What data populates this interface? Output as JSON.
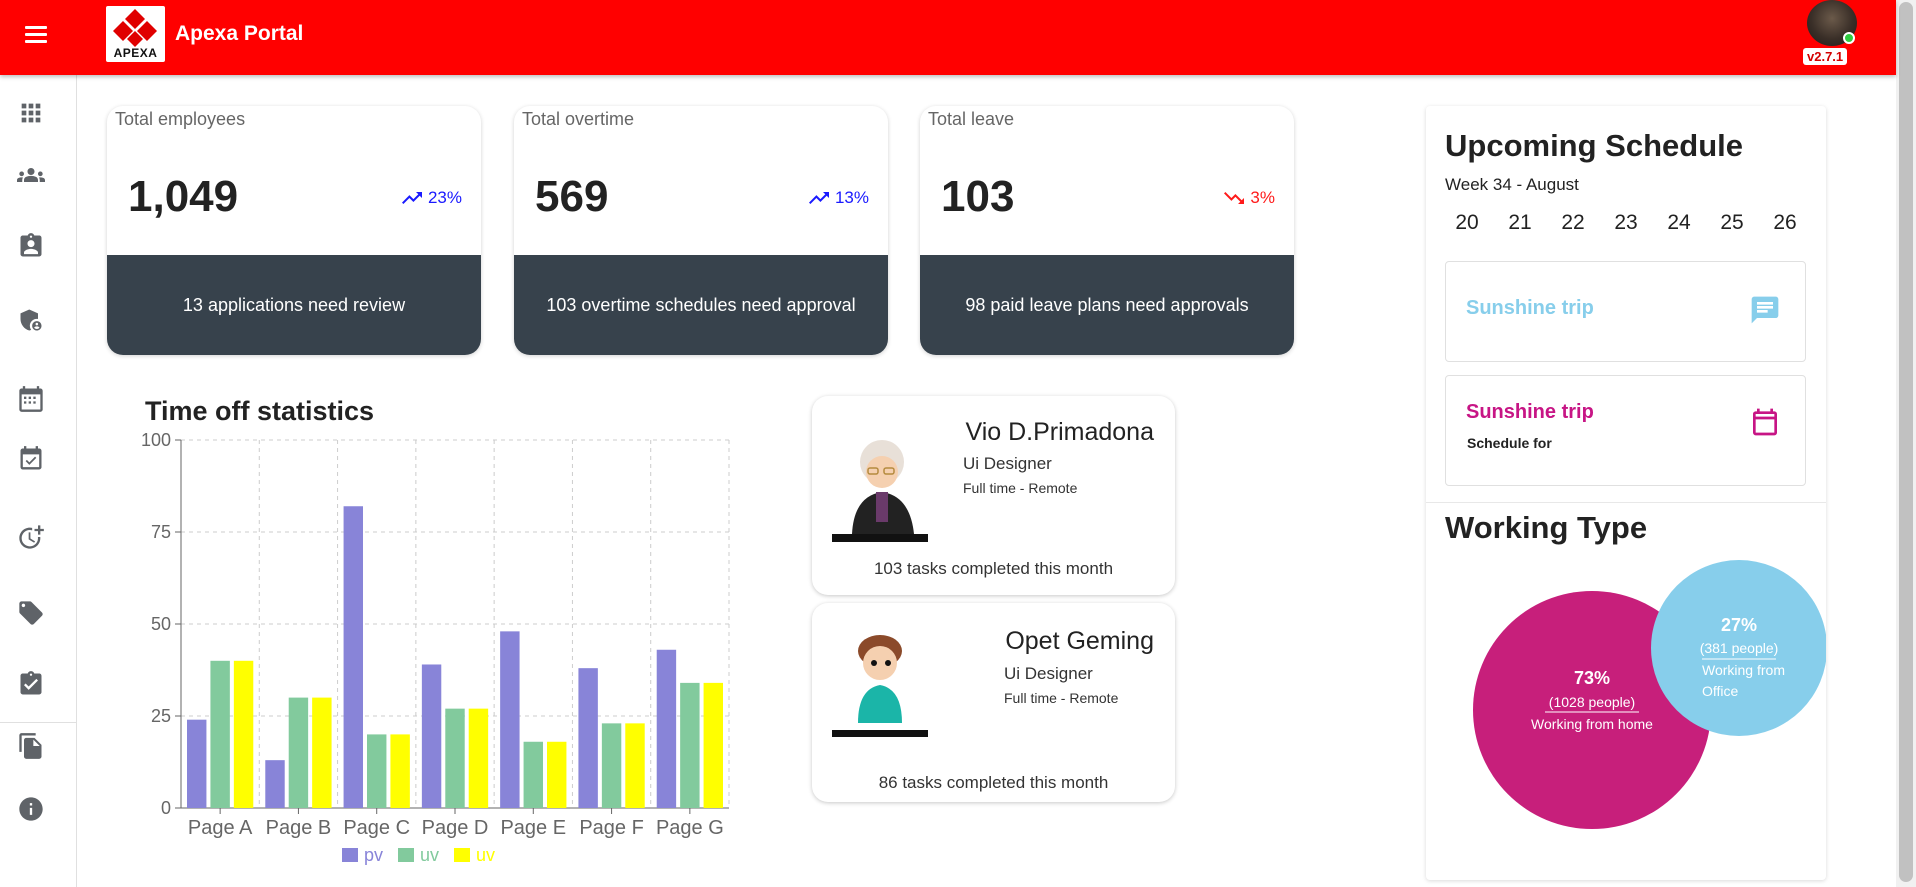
{
  "app": {
    "brand": "Apexa Portal",
    "logo_text": "APEXA",
    "version": "v2.7.1"
  },
  "sidebar": {
    "items": [
      {
        "name": "apps-grid-icon"
      },
      {
        "name": "people-icon"
      },
      {
        "name": "contact-card-icon"
      },
      {
        "name": "security-user-icon"
      },
      {
        "name": "calendar-icon"
      },
      {
        "name": "event-available-icon"
      },
      {
        "name": "more-time-icon"
      },
      {
        "name": "tag-icon"
      },
      {
        "name": "assignment-check-icon"
      },
      {
        "name": "file-copy-icon"
      },
      {
        "name": "info-icon"
      }
    ]
  },
  "stats": [
    {
      "title": "Total employees",
      "value": "1,049",
      "trend": "23%",
      "direction": "up",
      "footer": "13 applications need review"
    },
    {
      "title": "Total overtime",
      "value": "569",
      "trend": "13%",
      "direction": "up",
      "footer": "103 overtime schedules need approval"
    },
    {
      "title": "Total leave",
      "value": "103",
      "trend": "3%",
      "direction": "down",
      "footer": "98 paid leave plans need approvals"
    }
  ],
  "chart_title": "Time off statistics",
  "chart_data": {
    "type": "bar",
    "title": "Time off statistics",
    "categories": [
      "Page A",
      "Page B",
      "Page C",
      "Page D",
      "Page E",
      "Page F",
      "Page G"
    ],
    "series": [
      {
        "name": "pv",
        "color": "#8884d8",
        "values": [
          24,
          13,
          82,
          39,
          48,
          38,
          43
        ]
      },
      {
        "name": "uv",
        "color": "#82ca9d",
        "values": [
          40,
          30,
          20,
          27,
          18,
          23,
          34
        ]
      },
      {
        "name": "uv",
        "color": "#ffff00",
        "values": [
          40,
          30,
          20,
          27,
          18,
          23,
          34
        ]
      }
    ],
    "ylim": [
      0,
      100
    ],
    "yticks": [
      "0",
      "25",
      "50",
      "75",
      "100"
    ],
    "grid": true,
    "legend": "bottom"
  },
  "employees": [
    {
      "name": "Vio D.Primadona",
      "role": "Ui Designer",
      "type": "Full time - Remote",
      "tasks": "103 tasks completed this month"
    },
    {
      "name": "Opet Geming",
      "role": "Ui Designer",
      "type": "Full time - Remote",
      "tasks": "86 tasks completed this month"
    }
  ],
  "schedule": {
    "title": "Upcoming Schedule",
    "week": "Week 34 - August",
    "days": [
      "20",
      "21",
      "22",
      "23",
      "24",
      "25",
      "26"
    ],
    "events": [
      {
        "title": "Sunshine trip",
        "subtitle": "",
        "color": "#87ceeb",
        "icon": "chat-icon"
      },
      {
        "title": "Sunshine trip",
        "subtitle": "Schedule for",
        "color": "#c71585",
        "icon": "calendar-icon"
      }
    ]
  },
  "working_type": {
    "title": "Working Type",
    "segments": [
      {
        "percent": "73%",
        "people": "(1028 people)",
        "label": "Working from home",
        "color": "#c71f7b",
        "value": 73
      },
      {
        "percent": "27%",
        "people": "(381 people)",
        "label_line1": "Working from",
        "label_line2": "Office",
        "color": "#87ceeb",
        "value": 27
      }
    ]
  }
}
